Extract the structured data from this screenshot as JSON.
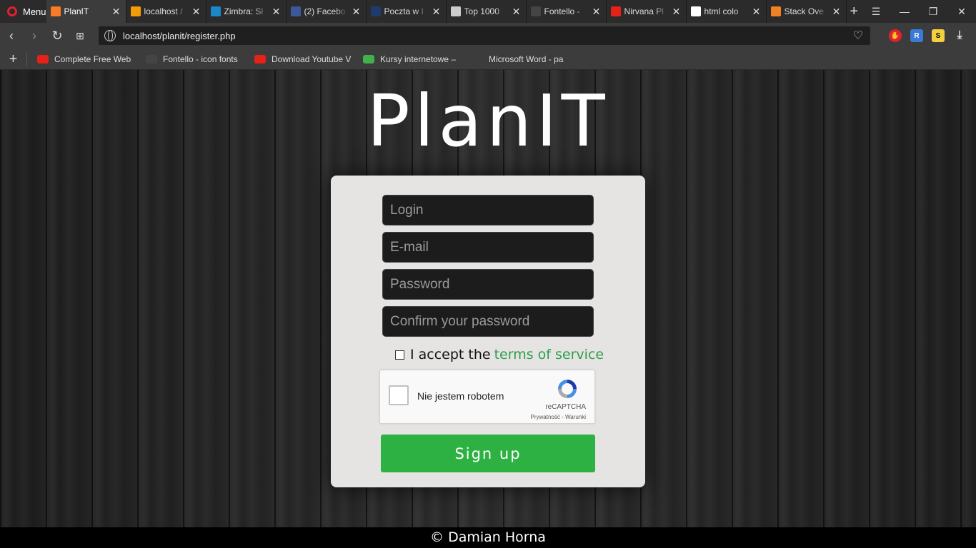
{
  "browser": {
    "menu_label": "Menu",
    "tabs": [
      {
        "title": "PlanIT",
        "icon": "xampp-icon",
        "color": "#fb7a24",
        "active": true
      },
      {
        "title": "localhost /",
        "icon": "phpmyadmin-icon",
        "color": "#f29b05",
        "active": false
      },
      {
        "title": "Zimbra: Sł",
        "icon": "zimbra-icon",
        "color": "#1a88c9",
        "active": false
      },
      {
        "title": "(2) Facebo",
        "icon": "facebook-icon",
        "color": "#3b5998",
        "active": false
      },
      {
        "title": "Poczta w I",
        "icon": "interia-icon",
        "color": "#1e3a6e",
        "active": false
      },
      {
        "title": "Top 1000",
        "icon": "document-icon",
        "color": "#cccccc",
        "active": false
      },
      {
        "title": "Fontello -",
        "icon": "fontello-icon",
        "color": "#444444",
        "active": false
      },
      {
        "title": "Nirvana Pl",
        "icon": "youtube-icon",
        "color": "#e62117",
        "active": false
      },
      {
        "title": "html colo",
        "icon": "google-icon",
        "color": "#ffffff",
        "active": false
      },
      {
        "title": "Stack Ove",
        "icon": "stackoverflow-icon",
        "color": "#f48024",
        "active": false
      }
    ],
    "url": "localhost/planit/register.php",
    "bookmarks": [
      {
        "title": "Complete Free Web",
        "icon": "youtube-icon",
        "color": "#e62117"
      },
      {
        "title": "Fontello - icon fonts",
        "icon": "fontello-icon",
        "color": "#444444"
      },
      {
        "title": "Download Youtube V",
        "icon": "youtube-icon",
        "color": "#e62117"
      },
      {
        "title": "Kursy internetowe –",
        "icon": "udemy-icon",
        "color": "#40b14b"
      },
      {
        "title": "Microsoft Word - pa",
        "icon": "none",
        "color": "#3c3c3c"
      }
    ]
  },
  "page": {
    "logo_title": "PlanIT",
    "form": {
      "login_placeholder": "Login",
      "email_placeholder": "E-mail",
      "password_placeholder": "Password",
      "confirm_placeholder": "Confirm your password",
      "accept_text": "I accept the",
      "terms_link": "terms of service",
      "captcha_label": "Nie jestem robotem",
      "captcha_brand": "reCAPTCHA",
      "captcha_links": "Prywatność - Warunki",
      "signup_label": "Sign up"
    },
    "footer": "© Damian Horna"
  },
  "colors": {
    "accent_green": "#2db142",
    "link_green": "#2e9e4a",
    "card_bg": "#e5e4e3"
  }
}
